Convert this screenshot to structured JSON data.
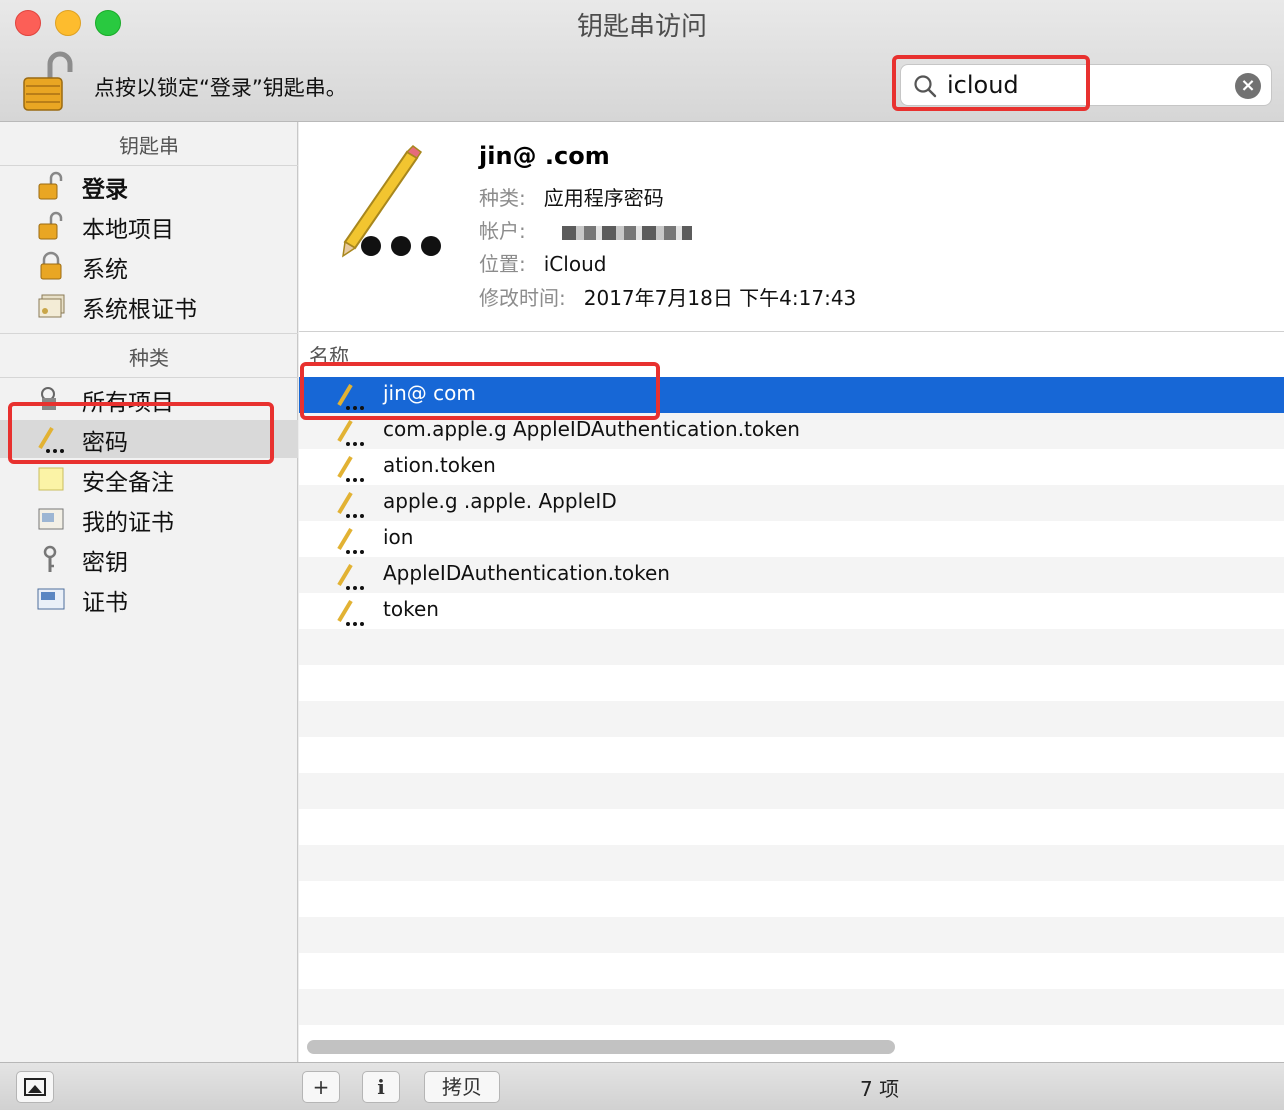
{
  "window": {
    "title": "钥匙串访问"
  },
  "toolbar": {
    "lock_text": "点按以锁定“登录”钥匙串。"
  },
  "search": {
    "value": "icloud",
    "placeholder": ""
  },
  "sidebar": {
    "keychains_header": "钥匙串",
    "keychains": [
      {
        "label": "登录",
        "icon": "unlocked-padlock-icon",
        "bold": true
      },
      {
        "label": "本地项目",
        "icon": "unlocked-padlock-icon"
      },
      {
        "label": "系统",
        "icon": "locked-padlock-icon"
      },
      {
        "label": "系统根证书",
        "icon": "certificate-stack-icon"
      }
    ],
    "categories_header": "种类",
    "categories": [
      {
        "label": "所有项目",
        "icon": "all-items-icon"
      },
      {
        "label": "密码",
        "icon": "password-icon",
        "selected": true
      },
      {
        "label": "安全备注",
        "icon": "secure-note-icon"
      },
      {
        "label": "我的证书",
        "icon": "my-certificate-icon"
      },
      {
        "label": "密钥",
        "icon": "key-icon"
      },
      {
        "label": "证书",
        "icon": "certificate-icon"
      }
    ]
  },
  "detail": {
    "title": "jin@ .com",
    "kind_label": "种类:",
    "kind_value": "应用程序密码",
    "account_label": "帐户:",
    "account_value": "",
    "where_label": "位置:",
    "where_value": "iCloud",
    "modified_label": "修改时间:",
    "modified_value": "2017年7月18日 下午4:17:43"
  },
  "list": {
    "column_name": "名称",
    "rows": [
      {
        "name": "jin@ com",
        "selected": true
      },
      {
        "name": "com.apple.g AppleIDAuthentication.token"
      },
      {
        "name": "ation.token"
      },
      {
        "name": "apple.g .apple. AppleID"
      },
      {
        "name": "ion"
      },
      {
        "name": "AppleIDAuthentication.token"
      },
      {
        "name": "token"
      }
    ]
  },
  "bottombar": {
    "add_label": "+",
    "info_label": "i",
    "copy_label": "拷贝",
    "status": "7 项"
  },
  "colors": {
    "selection": "#1767d6",
    "annotation": "#e8312f"
  }
}
